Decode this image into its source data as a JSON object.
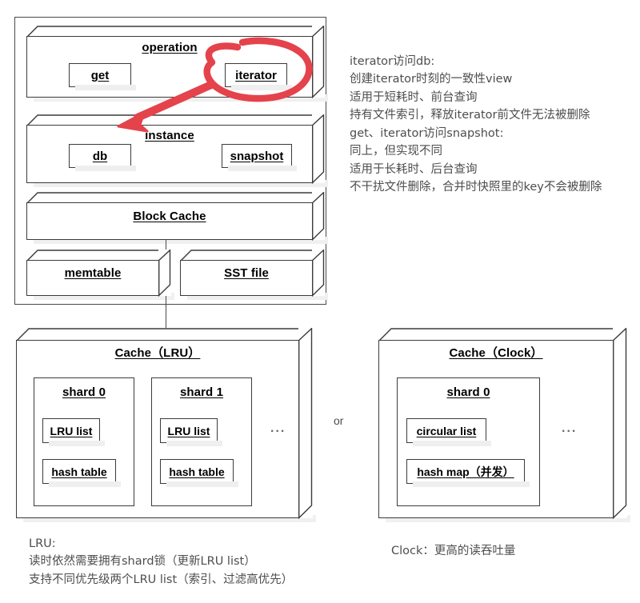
{
  "diagram": {
    "title_group": {
      "operation_box": {
        "label": "operation",
        "items": [
          {
            "label": "get"
          },
          {
            "label": "iterator"
          }
        ]
      },
      "instance_box": {
        "label": "instance",
        "items": [
          {
            "label": "db"
          },
          {
            "label": "snapshot"
          }
        ]
      },
      "block_cache_box": {
        "label": "Block Cache"
      },
      "storage_boxes": [
        {
          "label": "memtable"
        },
        {
          "label": "SST file"
        }
      ]
    },
    "cache_lru": {
      "title": "Cache（LRU）",
      "shards": [
        {
          "title": "shard 0",
          "items": [
            {
              "label": "LRU list"
            },
            {
              "label": "hash table"
            }
          ]
        },
        {
          "title": "shard 1",
          "items": [
            {
              "label": "LRU list"
            },
            {
              "label": "hash table"
            }
          ]
        }
      ],
      "more_indicator": "..."
    },
    "cache_clock": {
      "title": "Cache（Clock）",
      "shards": [
        {
          "title": "shard 0",
          "items": [
            {
              "label": "circular list"
            },
            {
              "label": "hash map（并发）"
            }
          ]
        }
      ],
      "more_indicator": "..."
    },
    "or_label": "or"
  },
  "notes": {
    "iterator_note": "iterator访问db:\n创建iterator时刻的一致性view\n适用于短耗时、前台查询\n持有文件索引，释放iterator前文件无法被删除\nget、iterator访问snapshot:\n同上，但实现不同\n适用于长耗时、后台查询\n不干扰文件删除，合并时快照里的key不会被删除",
    "lru_note": "LRU:\n读时依然需要拥有shard锁（更新LRU list）\n支持不同优先级两个LRU list（索引、过滤高优先）",
    "clock_note": "Clock：更高的读吞吐量"
  },
  "colors": {
    "annotation_red": "#e4434c",
    "box_stroke": "#3b3b3b",
    "frame_stroke": "#4a4a4a",
    "text": "#4d4d4d",
    "shadow": "#efefef"
  }
}
